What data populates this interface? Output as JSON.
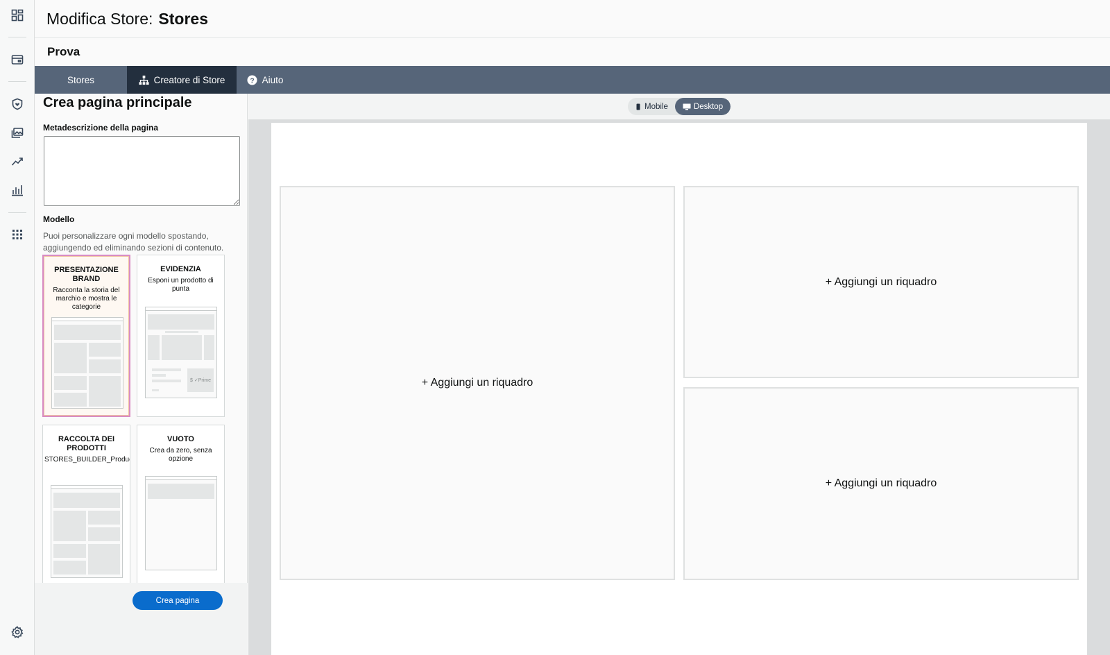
{
  "header": {
    "title_prefix": "Modifica Store:",
    "title_store": "Stores"
  },
  "subheader": {
    "page_name": "Prova"
  },
  "tabs": [
    {
      "label": "Stores",
      "icon": ""
    },
    {
      "label": "Creatore di Store",
      "icon": "sitemap-icon"
    },
    {
      "label": "Aiuto",
      "icon": "question-circle-icon"
    }
  ],
  "rail_icons": [
    "dashboard-icon",
    "store-card-icon",
    "shield-heart-icon",
    "gallery-icon",
    "trend-line-icon",
    "bar-chart-icon",
    "apps-grid-icon",
    "gear-icon"
  ],
  "panel": {
    "title": "Crea pagina principale",
    "meta_label": "Metadescrizione della pagina",
    "meta_value": "",
    "model_label": "Modello",
    "model_desc": "Puoi personalizzare ogni modello spostando, aggiungendo ed eliminando sezioni di contenuto.",
    "templates": [
      {
        "title": "PRESENTAZIONE BRAND",
        "desc": "Racconta la storia del marchio e mostra le categorie",
        "selected": true
      },
      {
        "title": "EVIDENZIA",
        "desc": "Esponi un prodotto di punta",
        "selected": false,
        "price_tag": "$ ✓Prime"
      },
      {
        "title": "RACCOLTA DEI PRODOTTI",
        "desc": "STORES_BUILDER_ProductCollectionTemplateDescription",
        "selected": false
      },
      {
        "title": "VUOTO",
        "desc": "Crea da zero, senza opzione",
        "selected": false
      }
    ],
    "create_button": "Crea pagina"
  },
  "preview": {
    "toggle": {
      "mobile": "Mobile",
      "desktop": "Desktop",
      "active": "Desktop"
    },
    "slots": [
      "+ Aggiungi un riquadro",
      "+ Aggiungi un riquadro",
      "+ Aggiungi un riquadro"
    ]
  },
  "colors": {
    "tabbar": "#566579",
    "active_tab": "#232f3e",
    "primary_button": "#0a6ccc",
    "selected_card_border": "#d88cc4"
  }
}
